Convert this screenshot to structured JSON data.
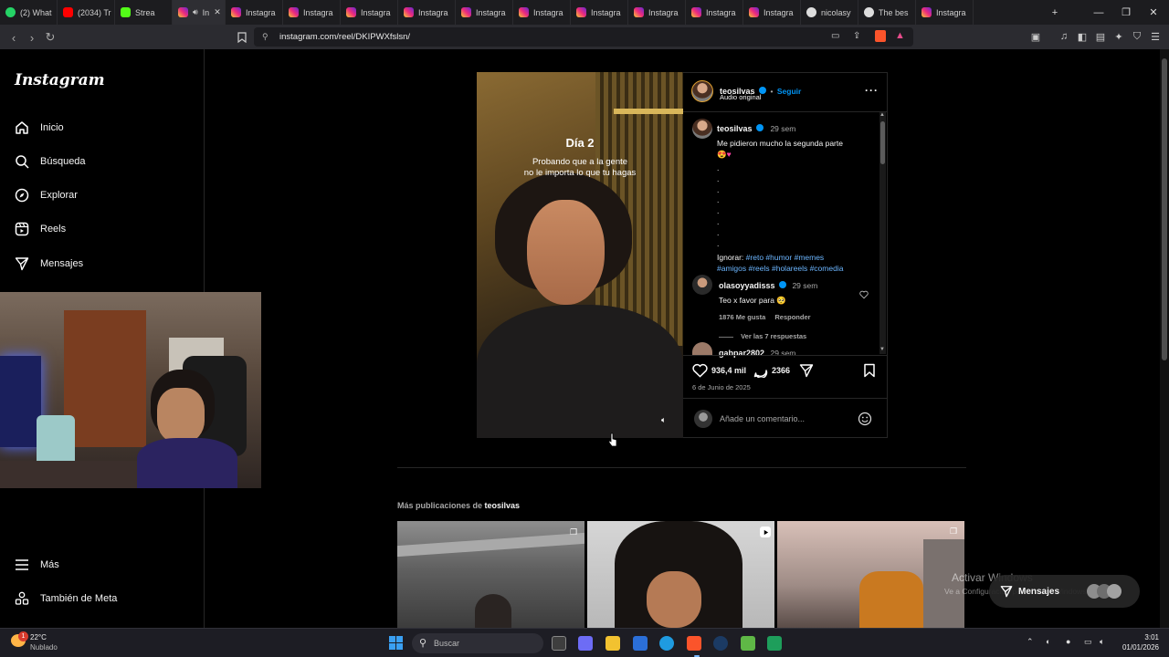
{
  "browser": {
    "tabs": [
      {
        "label": "(2) What",
        "icon": "whatsapp-icon"
      },
      {
        "label": "(2034) Tr",
        "icon": "youtube-icon"
      },
      {
        "label": "Strea",
        "icon": "kick-icon"
      },
      {
        "label": "In",
        "icon": "instagram-icon",
        "active": true
      },
      {
        "label": "Instagra",
        "icon": "instagram-icon"
      },
      {
        "label": "Instagra",
        "icon": "instagram-icon"
      },
      {
        "label": "Instagra",
        "icon": "instagram-icon"
      },
      {
        "label": "Instagra",
        "icon": "instagram-icon"
      },
      {
        "label": "Instagra",
        "icon": "instagram-icon"
      },
      {
        "label": "Instagra",
        "icon": "instagram-icon"
      },
      {
        "label": "Instagra",
        "icon": "instagram-icon"
      },
      {
        "label": "Instagra",
        "icon": "instagram-icon"
      },
      {
        "label": "Instagra",
        "icon": "instagram-icon"
      },
      {
        "label": "Instagra",
        "icon": "instagram-icon"
      },
      {
        "label": "nicolasy",
        "icon": "generic-site-icon"
      },
      {
        "label": "The bes",
        "icon": "generic-site-icon"
      },
      {
        "label": "Instagra",
        "icon": "instagram-icon"
      }
    ],
    "url": "instagram.com/reel/DKIPWXfslsn/"
  },
  "sidebar": {
    "logo": "Instagram",
    "items": [
      {
        "label": "Inicio",
        "icon": "home-icon"
      },
      {
        "label": "Búsqueda",
        "icon": "search-icon"
      },
      {
        "label": "Explorar",
        "icon": "compass-icon"
      },
      {
        "label": "Reels",
        "icon": "reels-icon"
      },
      {
        "label": "Mensajes",
        "icon": "send-icon"
      }
    ],
    "more_label": "Más",
    "meta_label": "También de Meta"
  },
  "post": {
    "video_title": "Día 2",
    "video_subtitle_1": "Probando que a la gente",
    "video_subtitle_2": "no le importa lo que tu hagas",
    "author": "teosilvas",
    "follow": "Seguir",
    "audio": "Audio original",
    "caption_author": "teosilvas",
    "caption_age": "29 sem",
    "caption_text": "Me pidieron mucho la segunda parte",
    "ignore_label": "Ignorar:",
    "hashtags_1": "#reto #humor #memes",
    "hashtags_2": "#amigos #reels #holareels #comedia",
    "comment1_author": "olasoyyadisss",
    "comment1_age": "29 sem",
    "comment1_text": "Teo x favor para",
    "comment1_likes": "1876 Me gusta",
    "comment1_reply": "Responder",
    "comment1_replies": "Ver las 7 respuestas",
    "comment2_author": "gabpar2802",
    "comment2_age": "29 sem",
    "likes": "936,4 mil",
    "comments": "2366",
    "date": "6 de Junio de 2025",
    "add_comment_placeholder": "Añade un comentario..."
  },
  "more_posts": {
    "prefix": "Más publicaciones de ",
    "author": "teosilvas"
  },
  "overlay": {
    "activate_windows": "Activar Windows",
    "activate_sub": "Ve a Configuración para activar Windows.",
    "messages": "Mensajes"
  },
  "taskbar": {
    "weather_temp": "22°C",
    "weather_desc": "Nublado",
    "search_placeholder": "Buscar",
    "time": "3:01",
    "date": "01/01/2026",
    "notification_count": "1"
  }
}
